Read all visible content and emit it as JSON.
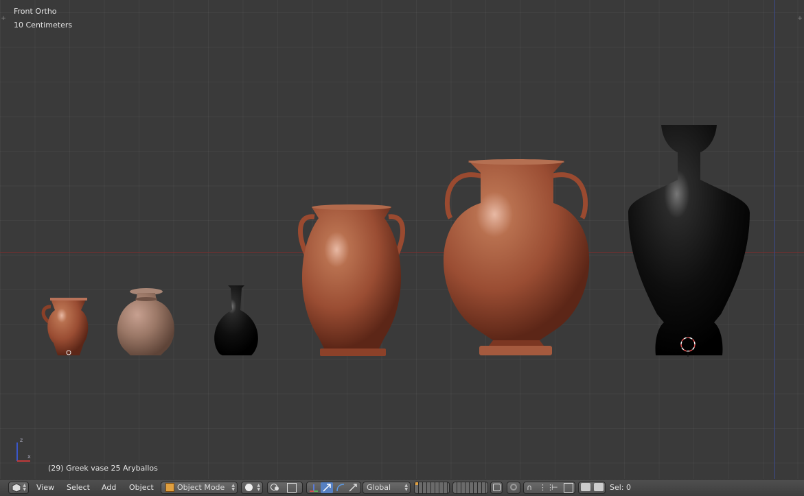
{
  "viewport": {
    "view_name": "Front Ortho",
    "scale_label": "10 Centimeters",
    "active_object": "(29) Greek vase 25 Aryballos",
    "gizmo_axes": [
      "z",
      "x"
    ],
    "colors": {
      "x_axis": "#7a2e2e",
      "z_axis": "#3b4a8c",
      "terracotta": "#a9573a",
      "black_glaze": "#111111"
    }
  },
  "header": {
    "menus": [
      "View",
      "Select",
      "Add",
      "Object"
    ],
    "mode": "Object Mode",
    "orientation": "Global",
    "selection_info": "Sel: 0"
  },
  "vases": [
    {
      "name": "small-oinochoe",
      "color": "terracotta"
    },
    {
      "name": "squat-jar",
      "color": "tan"
    },
    {
      "name": "black-lekythos",
      "color": "black"
    },
    {
      "name": "amphora",
      "color": "terracotta"
    },
    {
      "name": "krater-amphora",
      "color": "terracotta"
    },
    {
      "name": "black-loutrophoros",
      "color": "black"
    }
  ]
}
